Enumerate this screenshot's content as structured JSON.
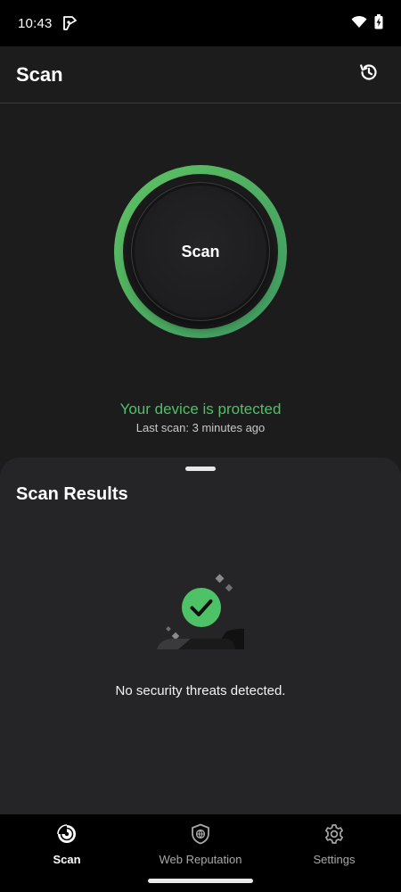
{
  "status_bar": {
    "time": "10:43",
    "notification_icon": "app-notification-icon",
    "wifi_icon": "wifi-icon",
    "battery_icon": "battery-charging-icon"
  },
  "app_bar": {
    "title": "Scan",
    "history_icon": "history-icon"
  },
  "scan": {
    "button_label": "Scan",
    "status": "Your device is protected",
    "last_scan": "Last scan: 3 minutes ago",
    "ring_color_start": "#5ec262",
    "ring_color_end": "#3f9a62",
    "status_color": "#4cc264"
  },
  "results": {
    "title": "Scan Results",
    "message": "No security threats detected.",
    "check_icon": "check-circle-icon"
  },
  "bottom_nav": {
    "items": [
      {
        "label": "Scan",
        "icon": "scan-radar-icon",
        "active": true
      },
      {
        "label": "Web Reputation",
        "icon": "shield-globe-icon",
        "active": false
      },
      {
        "label": "Settings",
        "icon": "gear-icon",
        "active": false
      }
    ]
  }
}
